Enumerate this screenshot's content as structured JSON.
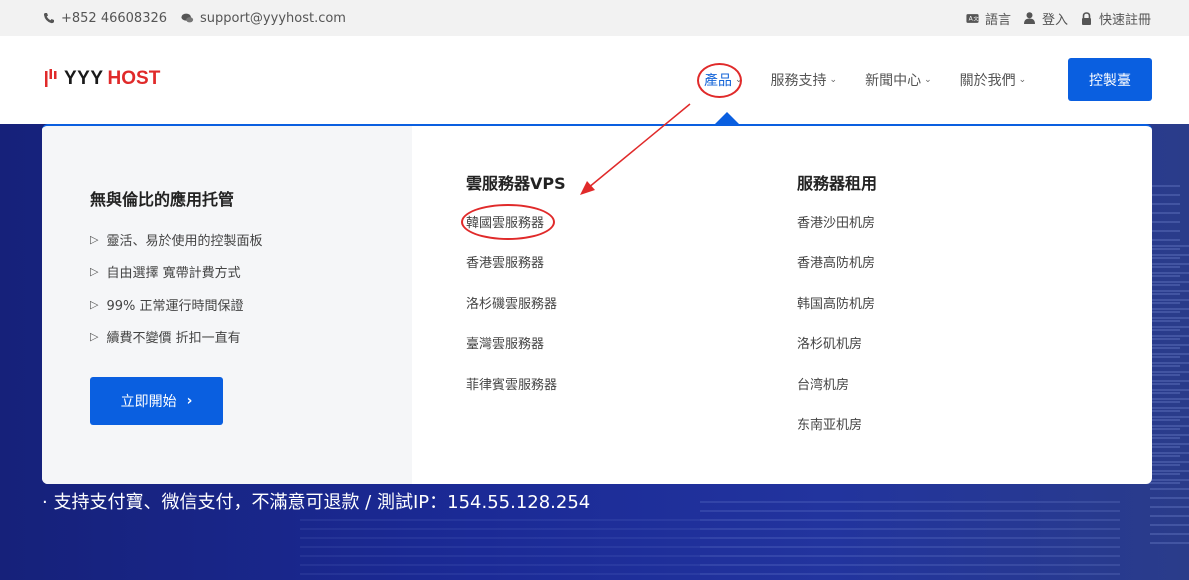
{
  "topbar": {
    "phone": "+852 46608326",
    "email": "support@yyyhost.com",
    "language": "語言",
    "login": "登入",
    "register": "快速註冊"
  },
  "logo": {
    "yyy": "YYY",
    "host": "HOST"
  },
  "nav": {
    "items": [
      {
        "label": "產品"
      },
      {
        "label": "服務支持"
      },
      {
        "label": "新聞中心"
      },
      {
        "label": "關於我們"
      }
    ],
    "cta": "控製臺"
  },
  "dropdown": {
    "promo": {
      "title": "無與倫比的應用托管",
      "features": [
        "靈活、易於使用的控製面板",
        "自由選擇 寬帶計費方式",
        "99% 正常運行時間保證",
        "續費不變價 折扣一直有"
      ],
      "button": "立即開始"
    },
    "vps": {
      "heading": "雲服務器VPS",
      "links": [
        "韓國雲服務器",
        "香港雲服務器",
        "洛杉磯雲服務器",
        "臺灣雲服務器",
        "菲律賓雲服務器"
      ]
    },
    "rental": {
      "heading": "服務器租用",
      "links": [
        "香港沙田机房",
        "香港高防机房",
        "韩国高防机房",
        "洛杉矶机房",
        "台湾机房",
        "东南亚机房"
      ]
    }
  },
  "hero": {
    "text": "· 支持支付寶、微信支付，不滿意可退款 / 測試IP：154.55.128.254"
  },
  "colors": {
    "accent": "#0a5fe0",
    "brand_red": "#e02a2a",
    "hero_bg": "#1b2a96"
  }
}
